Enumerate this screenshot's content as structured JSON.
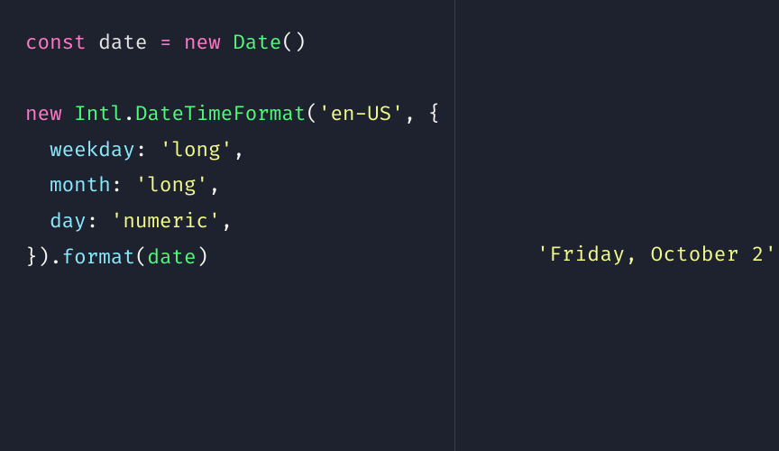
{
  "code": {
    "l1_const": "const",
    "l1_var": " date ",
    "l1_op": "= ",
    "l1_new": "new",
    "l1_space": " ",
    "l1_class": "Date",
    "l1_paren": "()",
    "l3_new": "new",
    "l3_space": " ",
    "l3_intl": "Intl",
    "l3_dot": ".",
    "l3_dtf": "DateTimeFormat",
    "l3_open": "(",
    "l3_str": "'en-US'",
    "l3_comma": ", {",
    "l4_indent": "  ",
    "l4_key": "weekday",
    "l4_colon": ": ",
    "l4_val": "'long'",
    "l4_comma": ",",
    "l5_indent": "  ",
    "l5_key": "month",
    "l5_colon": ": ",
    "l5_val": "'long'",
    "l5_comma": ",",
    "l6_indent": "  ",
    "l6_key": "day",
    "l6_colon": ": ",
    "l6_val": "'numeric'",
    "l6_comma": ",",
    "l7_close": "}).",
    "l7_format": "format",
    "l7_open": "(",
    "l7_arg": "date",
    "l7_close2": ")"
  },
  "output": {
    "value": "'Friday, October 2'"
  }
}
